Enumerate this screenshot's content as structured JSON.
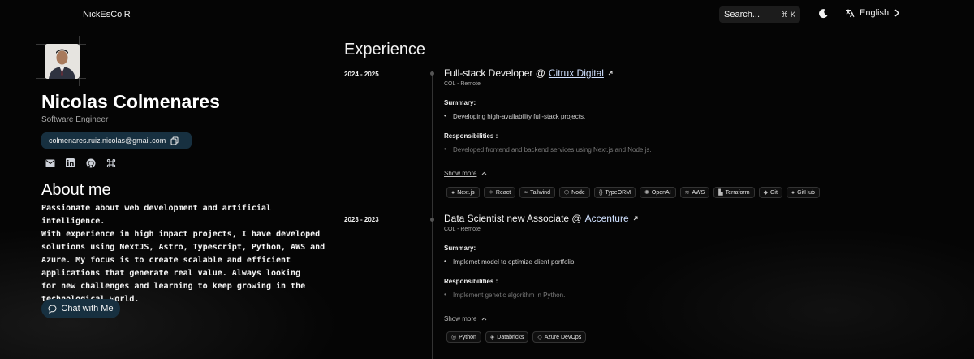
{
  "header": {
    "brand": "NickEsColR",
    "search_label": "Search...",
    "search_shortcut_mod": "⌘",
    "search_shortcut_key": "K",
    "language": "English"
  },
  "profile": {
    "name": "Nicolas Colmenares",
    "role": "Software Engineer",
    "email": "colmenares.ruiz.nicolas@gmail.com",
    "socials": [
      "mail-icon",
      "linkedin-icon",
      "github-icon",
      "command-icon"
    ]
  },
  "about": {
    "title": "About me",
    "text": "Passionate about web development and artificial intelligence.\nWith experience in high impact projects, I have developed\nsolutions using NextJS, Astro, Typescript, Python, AWS and\nAzure. My focus is to create scalable and efficient\napplications that generate real value. Always looking\nfor new challenges and learning to keep growing in the\ntechnological world.",
    "chat_button": "Chat with Me"
  },
  "experience": {
    "title": "Experience",
    "jobs": [
      {
        "period": "2024 - 2025",
        "title_prefix": "Full-stack Developer @ ",
        "company": "Citrux Digital",
        "location": "COL - Remote",
        "summary_heading": "Summary:",
        "summary": "Developing high-availability full-stack projects.",
        "responsibilities_heading": "Responsibilities :",
        "responsibility": "Developed frontend and backend services using Next.js and Node.js.",
        "show_more": "Show more",
        "tags": [
          "Next.js",
          "React",
          "Tailwind",
          "Node",
          "TypeORM",
          "OpenAI",
          "AWS",
          "Terraform",
          "Git",
          "GitHub"
        ]
      },
      {
        "period": "2023 - 2023",
        "title_prefix": "Data Scientist new Associate @ ",
        "company": "Accenture",
        "location": "COL - Remote",
        "summary_heading": "Summary:",
        "summary": "Implemet model to optimize client portfolio.",
        "responsibilities_heading": "Responsibilities :",
        "responsibility": "Implement genetic algorithm in Python.",
        "show_more": "Show more",
        "tags": [
          "Python",
          "Databricks",
          "Azure DevOps"
        ]
      }
    ]
  },
  "colors": {
    "background": "#050505",
    "pill": "#173040",
    "accent_link": "#cfe0ff"
  }
}
